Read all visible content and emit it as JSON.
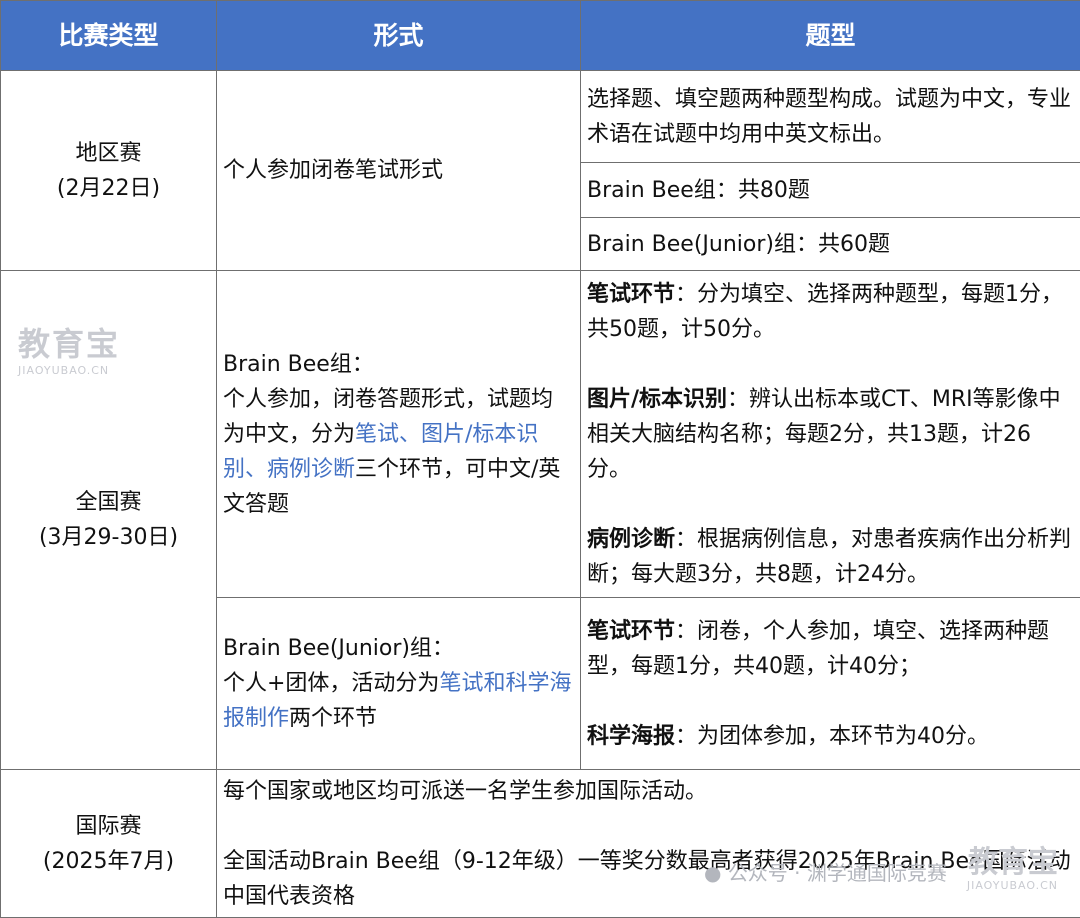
{
  "header": {
    "col1": "比赛类型",
    "col2": "形式",
    "col3": "题型"
  },
  "regional": {
    "name": "地区赛",
    "date": "(2月22日)",
    "format": "个人参加闭卷笔试形式",
    "rows": [
      "选择题、填空题两种题型构成。试题为中文，专业术语在试题中均用中英文标出。",
      "Brain Bee组：共80题",
      "Brain Bee(Junior)组：共60题"
    ]
  },
  "national": {
    "name": "全国赛",
    "date": "(3月29-30日)",
    "bb": {
      "title": "Brain Bee组：",
      "text_a": "个人参加，闭卷答题形式，试题均为中文，分为",
      "highlight": "笔试、图片/标本识别、病例诊断",
      "text_b": "三个环节，可中文/英文答题",
      "sections": [
        {
          "label": "笔试环节",
          "text": "：分为填空、选择两种题型，每题1分，共50题，计50分。"
        },
        {
          "label": "图片/标本识别",
          "text": "：辨认出标本或CT、MRI等影像中相关大脑结构名称；每题2分，共13题，计26分。"
        },
        {
          "label": "病例诊断",
          "text": "：根据病例信息，对患者疾病作出分析判断；每大题3分，共8题，计24分。"
        }
      ]
    },
    "junior": {
      "title": "Brain Bee(Junior)组：",
      "text_a": "个人+团体，活动分为",
      "highlight": "笔试和科学海报制作",
      "text_b": "两个环节",
      "sections": [
        {
          "label": "笔试环节",
          "text": "：闭卷，个人参加，填空、选择两种题型，每题1分，共40题，计40分；"
        },
        {
          "label": "科学海报",
          "text": "：为团体参加，本环节为40分。"
        }
      ]
    }
  },
  "international": {
    "name": "国际赛",
    "date": "(2025年7月)",
    "line1": "每个国家或地区均可派送一名学生参加国际活动。",
    "line2": "全国活动Brain Bee组（9-12年级）一等奖分数最高者获得2025年Brain Bee国际活动中国代表资格"
  },
  "watermarks": {
    "left_big": "教育宝",
    "left_small": "JIAOYUBAO.CN",
    "right_account": "公众号 · 渊学通国际竞赛",
    "right_big": "教育宝",
    "right_small": "JIAOYUBAO.CN"
  },
  "colors": {
    "header_bg": "#4472c4",
    "header_text": "#ffffff",
    "highlight": "#4472c4",
    "border": "#6f6f6f"
  }
}
